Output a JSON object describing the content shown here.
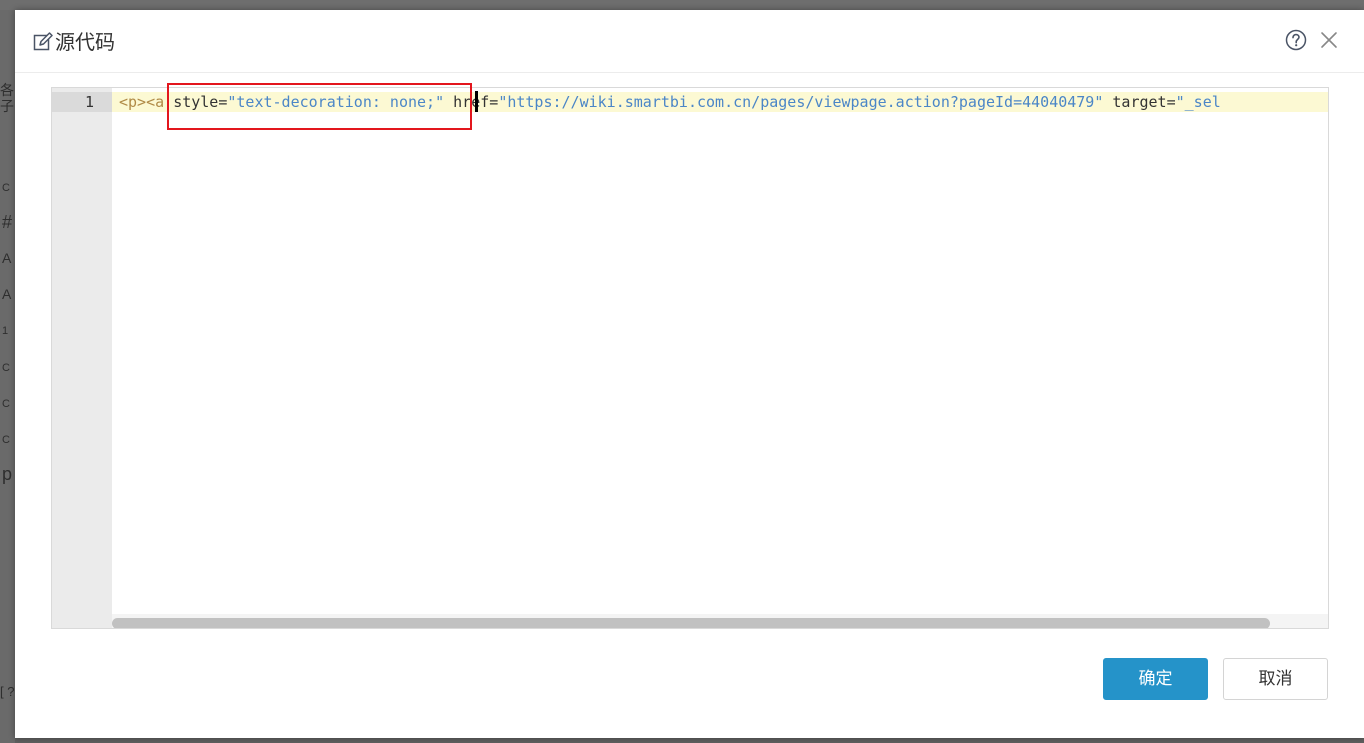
{
  "dialog": {
    "title": "源代码",
    "icons": {
      "title": "edit-icon",
      "help": "help-circle-icon",
      "close": "close-icon"
    }
  },
  "editor": {
    "line_number": "1",
    "tokens": {
      "open": "<p><a",
      "attr_style": "style=",
      "val_style": "\"text-decoration: none;\"",
      "attr_href": "href=",
      "val_href": "\"https://wiki.smartbi.com.cn/pages/viewpage.action?pageId=44040479\"",
      "attr_target": "target=",
      "val_target": "\"_sel"
    }
  },
  "footer": {
    "ok_label": "确定",
    "cancel_label": "取消"
  },
  "background_fragments": [
    "各子",
    "C",
    "#",
    "A",
    "A",
    "1",
    "C",
    "C",
    "C",
    "p",
    "[ ?"
  ],
  "colors": {
    "primary": "#2593c9",
    "highlight_border": "#e3161d",
    "active_line": "#fcf9d3",
    "tag": "#b08a46",
    "string": "#4b86c7"
  }
}
